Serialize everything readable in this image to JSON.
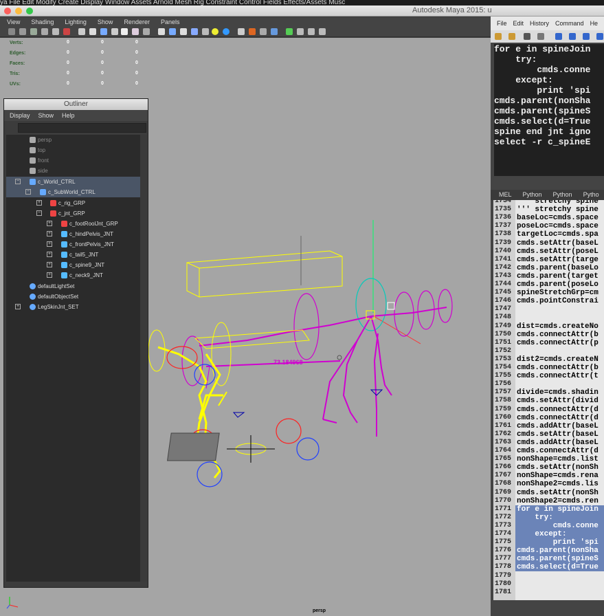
{
  "mac_menu": "ya  File  Edit  Modify  Create  Display  Window  Assets  Arnold  Mesh  Rig  Constraint  Control  Fields  Effects/Assets  Musc",
  "title": "Autodesk Maya 2015: u",
  "viewport_menu": [
    "View",
    "Shading",
    "Lighting",
    "Show",
    "Renderer",
    "Panels"
  ],
  "hud": {
    "labels": [
      "Verts:",
      "Edges:",
      "Faces:",
      "Tris:",
      "UVs:"
    ],
    "values": [
      "0",
      "0",
      "0"
    ]
  },
  "distance_label": "73.184968",
  "camera_label": "persp",
  "outliner": {
    "title": "Outliner",
    "menu": [
      "Display",
      "Show",
      "Help"
    ],
    "items": [
      {
        "label": "persp"
      },
      {
        "label": "top"
      },
      {
        "label": "front"
      },
      {
        "label": "side"
      },
      {
        "label": "c_World_CTRL"
      },
      {
        "label": "c_SubWorld_CTRL"
      },
      {
        "label": "c_rig_GRP"
      },
      {
        "label": "c_jnt_GRP"
      },
      {
        "label": "c_footRoolJnt_GRP"
      },
      {
        "label": "c_hindPelvis_JNT"
      },
      {
        "label": "c_frontPelvis_JNT"
      },
      {
        "label": "c_tail5_JNT"
      },
      {
        "label": "c_spine9_JNT"
      },
      {
        "label": "c_neck9_JNT"
      },
      {
        "label": "defaultLightSet"
      },
      {
        "label": "defaultObjectSet"
      },
      {
        "label": "LegSkinJnt_SET"
      }
    ]
  },
  "script_editor": {
    "menu": [
      "File",
      "Edit",
      "History",
      "Command",
      "He"
    ],
    "history": [
      "for e in spineJoin",
      "    try:",
      "        cmds.conne",
      "    except:",
      "        print 'spi",
      "cmds.parent(nonSha",
      "cmds.parent(spineS",
      "cmds.select(d=True",
      "",
      "",
      "spine end jnt igno",
      "select -r c_spineE"
    ],
    "tabs": [
      "MEL",
      "Python",
      "Python",
      "Pytho"
    ],
    "line_numbers": [
      "1734",
      "1735",
      "1736",
      "1737",
      "1738",
      "1739",
      "1740",
      "1741",
      "1742",
      "1743",
      "1744",
      "1745",
      "1746",
      "1747",
      "1748",
      "1749",
      "1750",
      "1751",
      "1752",
      "1753",
      "1754",
      "1755",
      "1756",
      "1757",
      "1758",
      "1759",
      "1760",
      "1761",
      "1762",
      "1763",
      "1764",
      "1765",
      "1766",
      "1767",
      "1768",
      "1769",
      "1770",
      "1771",
      "1772",
      "1773",
      "1774",
      "1775",
      "1776",
      "1777",
      "1778",
      "1779",
      "1780",
      "1781"
    ],
    "code": [
      "    stretchy spine",
      "''' stretchy spine",
      "baseLoc=cmds.space",
      "poseLoc=cmds.space",
      "targetLoc=cmds.spa",
      "cmds.setAttr(baseL",
      "cmds.setAttr(poseL",
      "cmds.setAttr(targe",
      "cmds.parent(baseLo",
      "cmds.parent(target",
      "cmds.parent(poseLo",
      "spineStretchGrp=cm",
      "cmds.pointConstrai",
      "",
      "",
      "dist=cmds.createNo",
      "cmds.connectAttr(b",
      "cmds.connectAttr(p",
      "",
      "dist2=cmds.createN",
      "cmds.connectAttr(b",
      "cmds.connectAttr(t",
      "",
      "divide=cmds.shadin",
      "cmds.setAttr(divid",
      "cmds.connectAttr(d",
      "cmds.connectAttr(d",
      "cmds.addAttr(baseL",
      "cmds.setAttr(baseL",
      "cmds.addAttr(baseL",
      "cmds.connectAttr(d",
      "nonShape=cmds.list",
      "cmds.setAttr(nonSh",
      "nonShape=cmds.rena",
      "nonShape2=cmds.lis",
      "cmds.setAttr(nonSh",
      "nonShape2=cmds.ren",
      "for e in spineJoin",
      "    try:",
      "        cmds.conne",
      "    except:",
      "        print 'spi",
      "cmds.parent(nonSha",
      "cmds.parent(spineS",
      "cmds.select(d=True",
      "",
      "",
      ""
    ]
  },
  "colors": {
    "viewport_bg": "#a5a5a5",
    "joint_magenta": "#d000d0",
    "joint_yellow": "#ffff00",
    "selection_blue": "#6b84b8"
  }
}
